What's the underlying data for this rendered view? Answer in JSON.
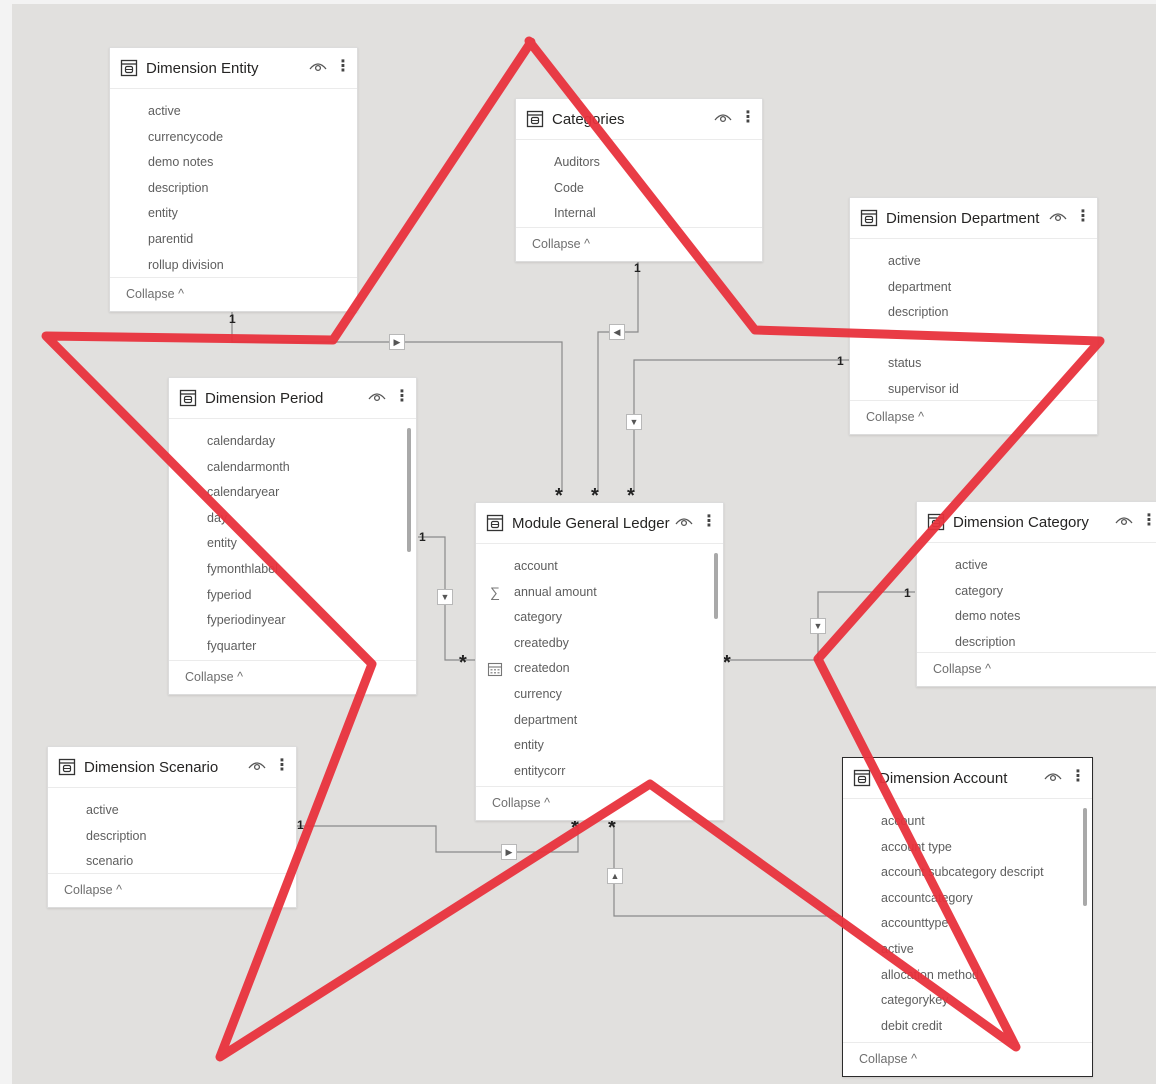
{
  "tables": {
    "entity": {
      "title": "Dimension Entity",
      "fields": [
        "active",
        "currencycode",
        "demo notes",
        "description",
        "entity",
        "parentid",
        "rollup division"
      ],
      "collapse": "Collapse ^"
    },
    "categories": {
      "title": "Categories",
      "fields": [
        "Auditors",
        "Code",
        "Internal"
      ],
      "collapse": "Collapse ^"
    },
    "department": {
      "title": "Dimension Department",
      "fields": [
        "active",
        "department",
        "description",
        "",
        "status",
        "supervisor id"
      ],
      "collapse": "Collapse ^"
    },
    "period": {
      "title": "Dimension Period",
      "fields": [
        "calendarday",
        "calendarmonth",
        "calendaryear",
        "day",
        "entity",
        "fymonthlabel",
        "fyperiod",
        "fyperiodinyear",
        "fyquarter"
      ],
      "collapse": "Collapse ^"
    },
    "ledger": {
      "title": "Module General Ledger",
      "fields": [
        "account",
        "annual amount",
        "category",
        "createdby",
        "createdon",
        "currency",
        "department",
        "entity",
        "entitycorr"
      ],
      "collapse": "Collapse ^"
    },
    "category": {
      "title": "Dimension Category",
      "fields": [
        "active",
        "category",
        "demo notes",
        "description"
      ],
      "collapse": "Collapse ^"
    },
    "scenario": {
      "title": "Dimension Scenario",
      "fields": [
        "active",
        "description",
        "scenario"
      ],
      "collapse": "Collapse ^"
    },
    "account": {
      "title": "Dimension Account",
      "fields": [
        "account",
        "account type",
        "account subcategory descript",
        "accountcategory",
        "accounttype",
        "active",
        "allocation method",
        "categorykey",
        "debit credit"
      ],
      "collapse": "Collapse ^"
    }
  },
  "cardinality": {
    "one": "1",
    "many": "*"
  },
  "overlay": {
    "shape": "star",
    "color": "#e8323c"
  }
}
